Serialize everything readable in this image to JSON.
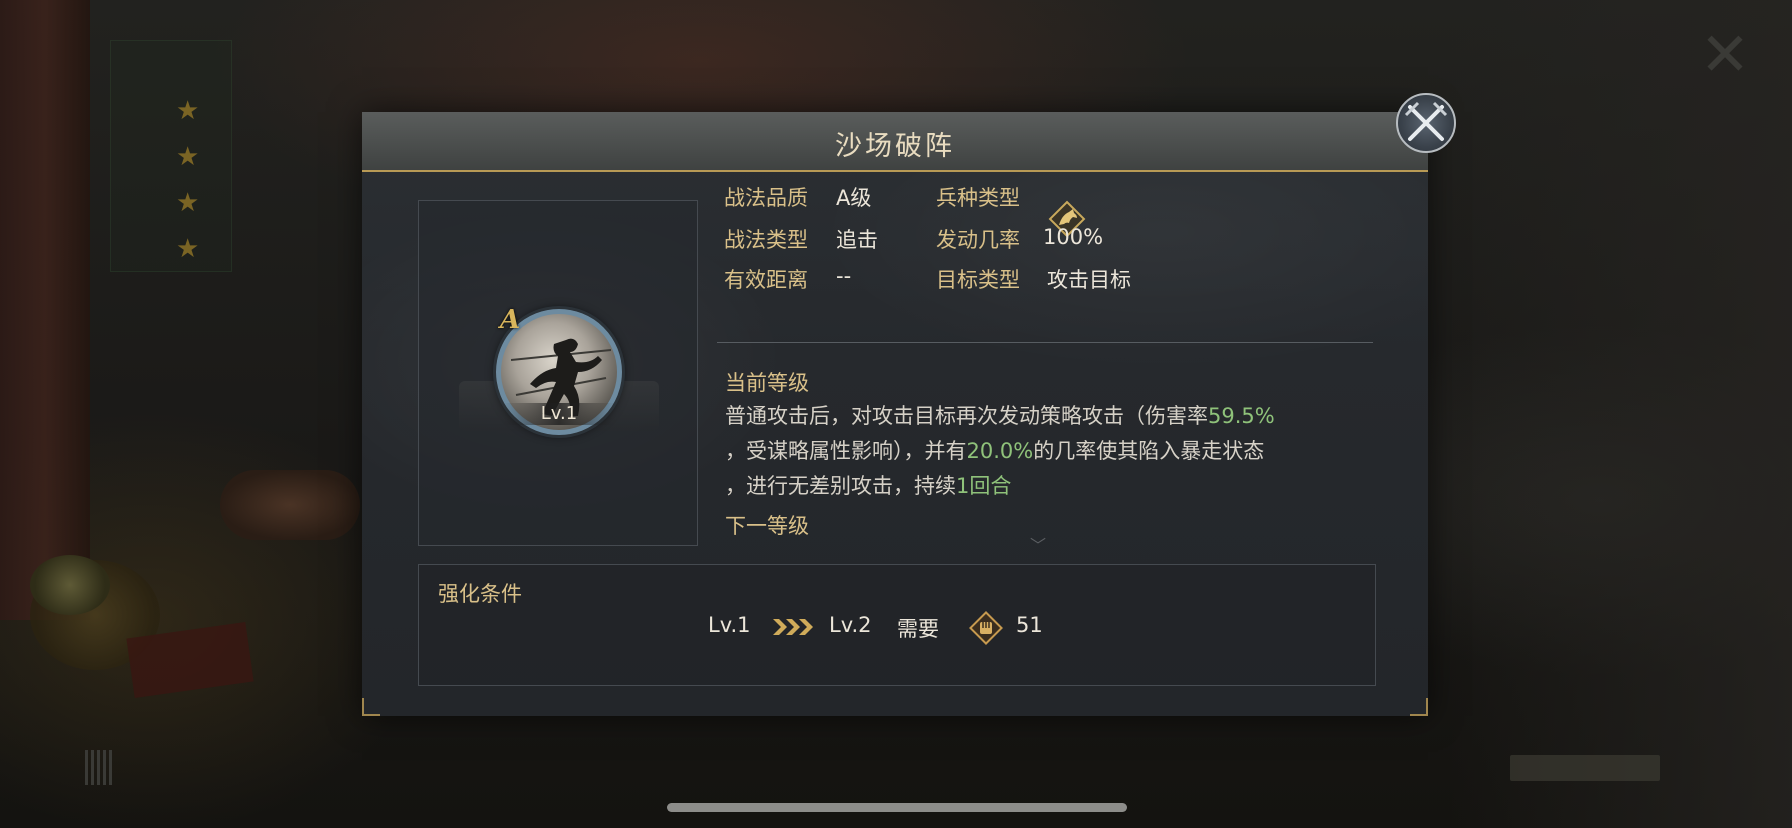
{
  "dialog": {
    "title": "沙场破阵",
    "close_icon": "crossed-swords-close-icon"
  },
  "skill": {
    "grade": "A",
    "level": "Lv.1",
    "icon": "warrior-silhouette-icon"
  },
  "attributes": {
    "quality_label": "战法品质",
    "quality_value": "A级",
    "troop_type_label": "兵种类型",
    "troop_type_icon": "horse-cavalry-icon",
    "skill_type_label": "战法类型",
    "skill_type_value": "追击",
    "trigger_rate_label": "发动几率",
    "trigger_rate_value": "100%",
    "range_label": "有效距离",
    "range_value": "--",
    "target_label": "目标类型",
    "target_value": "攻击目标"
  },
  "current_level": {
    "heading": "当前等级",
    "desc_part1": "普通攻击后，对攻击目标再次发动策略攻击（伤害率",
    "desc_hl1": "59.5%",
    "desc_part2": "，受谋略属性影响），并有",
    "desc_hl2": "20.0%",
    "desc_part3": "的几率使其陷入暴走状态",
    "desc_part4": "，进行无差别攻击，持续",
    "desc_hl3": "1回合"
  },
  "next_level": {
    "heading": "下一等级"
  },
  "enhance": {
    "title": "强化条件",
    "from_level": "Lv.1",
    "to_level": "Lv.2",
    "require_label": "需要",
    "resource_icon": "fist-token-icon",
    "cost": "51"
  },
  "colors": {
    "gold": "#d9c089",
    "highlight_green": "#8fc27a",
    "title_text": "#e9dcc0"
  }
}
